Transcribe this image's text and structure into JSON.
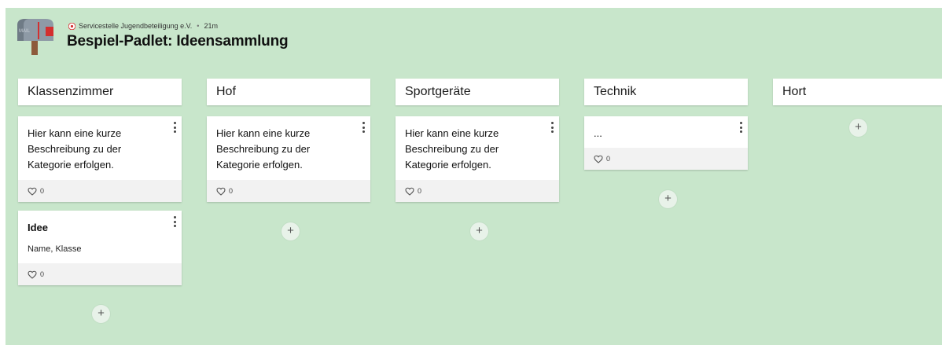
{
  "header": {
    "author": "Servicestelle Jugendbeteiligung e.V.",
    "age": "21m",
    "title": "Bespiel-Padlet: Ideensammlung",
    "mailbox_label": "MAIL"
  },
  "columns": [
    {
      "title": "Klassenzimmer",
      "posts": [
        {
          "text": "Hier kann eine kurze Beschreibung zu der Kategorie erfolgen.",
          "likes": "0"
        },
        {
          "title": "Idee",
          "subtitle": "Name, Klasse",
          "likes": "0"
        }
      ],
      "add_label": "+"
    },
    {
      "title": "Hof",
      "posts": [
        {
          "text": "Hier kann eine kurze Beschreibung zu der Kategorie erfolgen.",
          "likes": "0"
        }
      ],
      "add_label": "+"
    },
    {
      "title": "Sportgeräte",
      "posts": [
        {
          "text": "Hier kann eine kurze Beschreibung zu der Kategorie erfolgen.",
          "likes": "0"
        }
      ],
      "add_label": "+"
    },
    {
      "title": "Technik",
      "posts": [
        {
          "text": "...",
          "likes": "0"
        }
      ],
      "add_label": "+"
    },
    {
      "title": "Hort",
      "posts": [],
      "add_label": "+"
    }
  ],
  "colors": {
    "background": "#c8e6cb",
    "card": "#ffffff",
    "card_footer": "#f2f2f2",
    "mailbox_flag": "#d32f2f"
  },
  "icons": {
    "kebab": "more-vert-icon",
    "like": "heart-outline-icon",
    "add": "plus-icon",
    "wall_icon": "mailbox-icon",
    "author_logo": "organization-logo-icon"
  }
}
